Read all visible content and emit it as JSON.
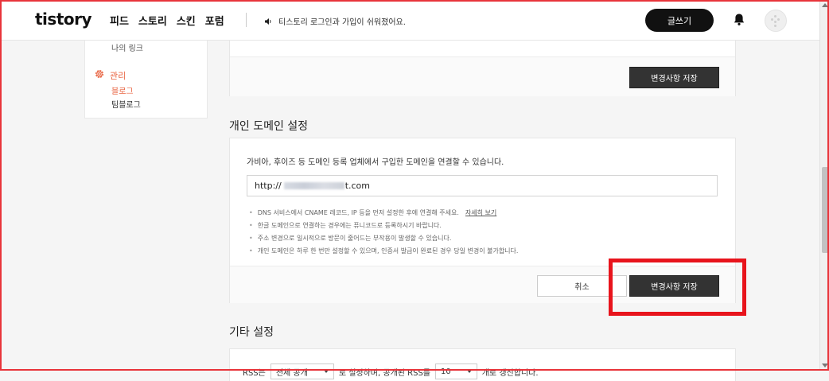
{
  "header": {
    "logo": "tistory",
    "nav": [
      "피드",
      "스토리",
      "스킨",
      "포럼"
    ],
    "notice": "티스토리 로그인과 가입이 쉬워졌어요.",
    "write_label": "글쓰기"
  },
  "sidebar": {
    "link_label": "나의 링크",
    "group_label": "관리",
    "sub_items": [
      "블로그",
      "팀블로그"
    ]
  },
  "top_panel": {
    "save_label": "변경사항 저장"
  },
  "domain": {
    "title": "개인 도메인 설정",
    "description": "가비아, 후이즈 등 도메인 등록 업체에서 구입한 도메인을 연결할 수 있습니다.",
    "url_prefix": "http://",
    "url_suffix": "t.com",
    "notes": [
      "DNS 서비스에서 CNAME 레코드, IP 등을 먼저 설정한 후에 연결해 주세요.",
      "한글 도메인으로 연결하는 경우에는 퓨니코드로 등록하시기 바랍니다.",
      "주소 변경으로 일시적으로 방문이 줄어드는 부작용이 발생할 수 있습니다.",
      "개인 도메인은 하루 한 번만 설정할 수 있으며, 인증서 발급이 완료된 경우 당일 변경이 불가합니다."
    ],
    "details_link": "자세히 보기",
    "cancel_label": "취소",
    "save_label": "변경사항 저장"
  },
  "etc": {
    "title": "기타 설정",
    "rss_prefix": "RSS는",
    "rss_select": "전체 공개",
    "rss_middle": "로 설정하며, 공개된 RSS를",
    "count_select": "10",
    "rss_suffix": "개로 갱신합니다."
  }
}
